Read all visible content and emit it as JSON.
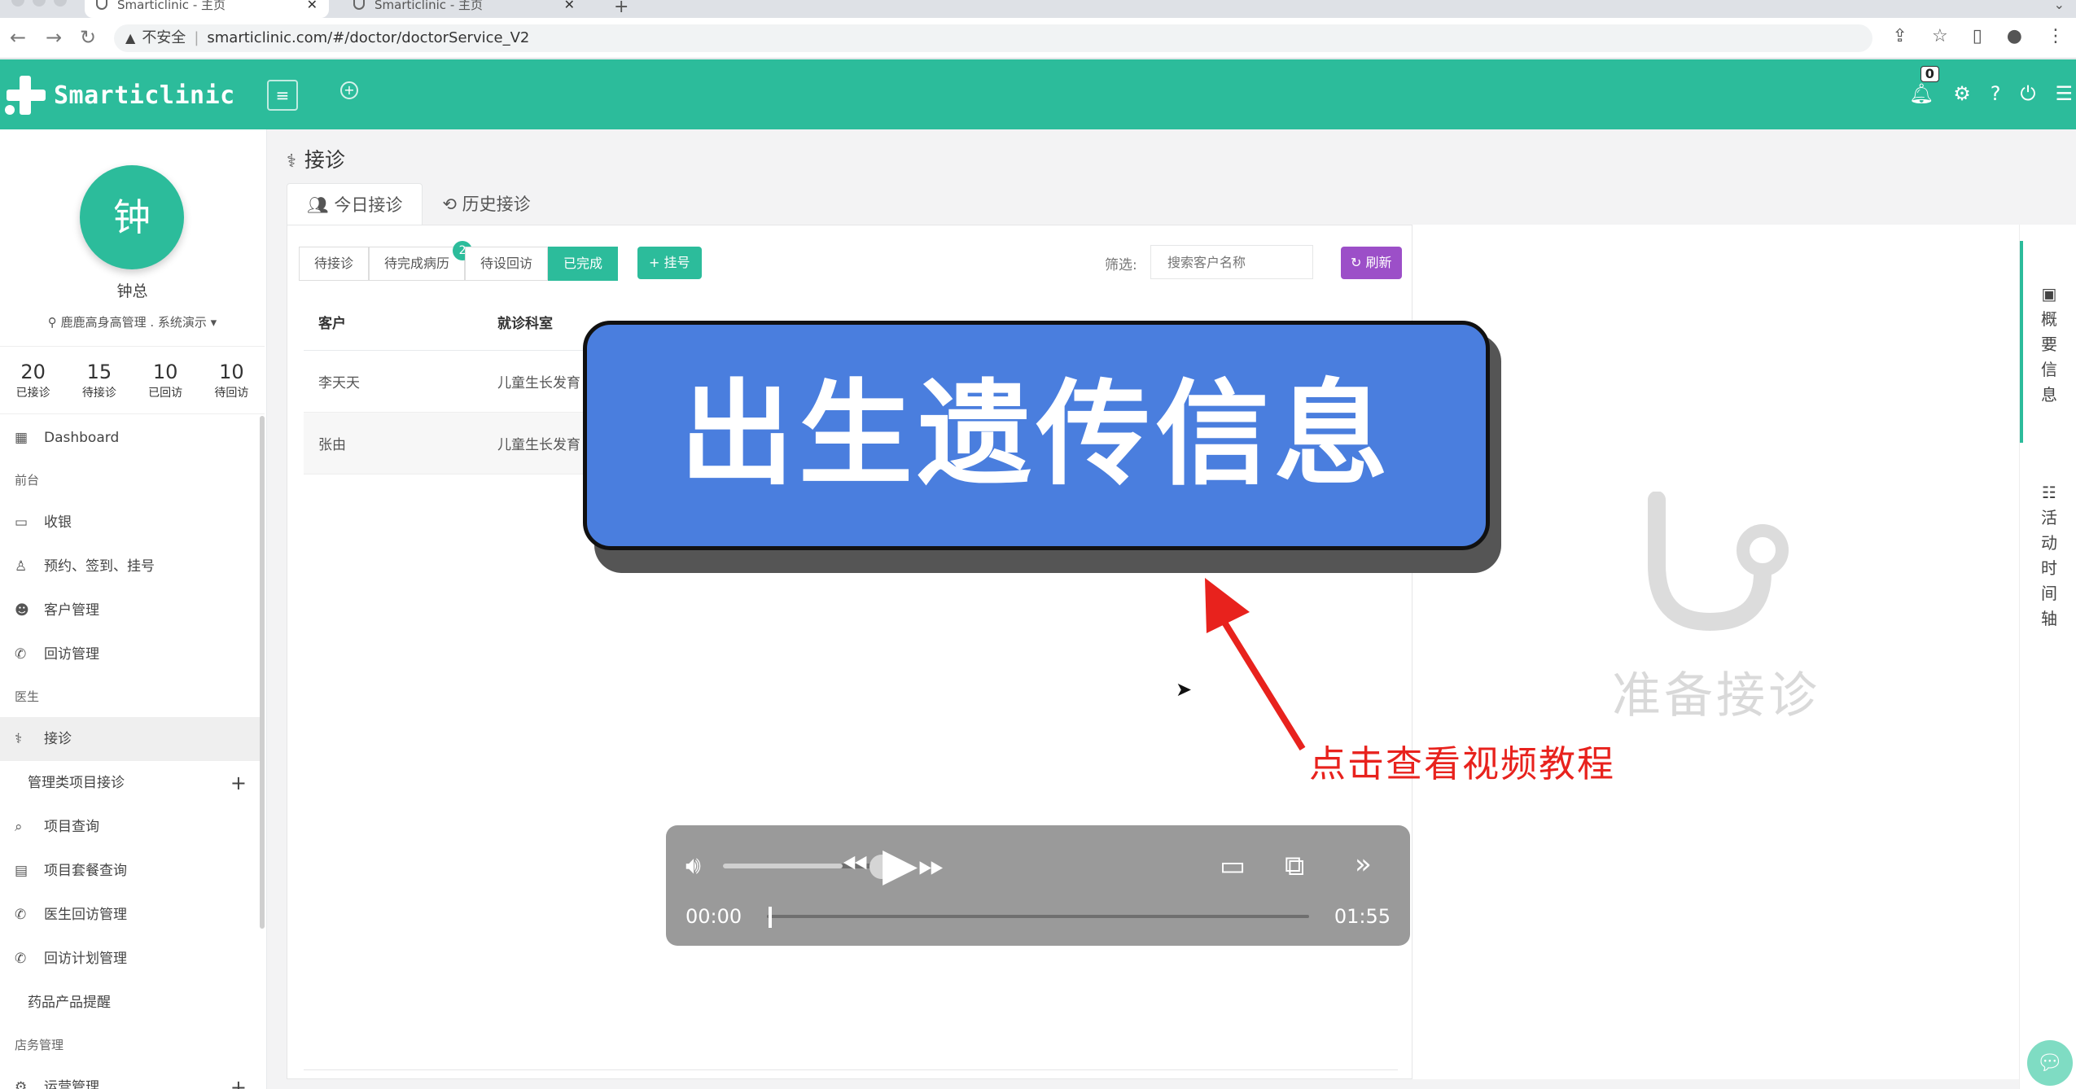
{
  "browser": {
    "tabs": [
      {
        "title": "Smarticlinic - 主页",
        "active": true
      },
      {
        "title": "Smarticlinic - 主页",
        "active": false
      }
    ],
    "security_label": "不安全",
    "url": "smarticlinic.com/#/doctor/doctorService_V2"
  },
  "header": {
    "logo_text": "Smarticlinic",
    "notification_count": "0",
    "brand_color": "#2cbc9b"
  },
  "sidebar": {
    "avatar_char": "钟",
    "user_name": "钟总",
    "org": "鹿鹿高身高管理 . 系统演示",
    "stats": [
      {
        "num": "20",
        "label": "已接诊"
      },
      {
        "num": "15",
        "label": "待接诊"
      },
      {
        "num": "10",
        "label": "已回访"
      },
      {
        "num": "10",
        "label": "待回访"
      }
    ],
    "dashboard": "Dashboard",
    "section_front": "前台",
    "cashier": "收银",
    "appointments": "预约、签到、挂号",
    "customers": "客户管理",
    "followup": "回访管理",
    "section_doctor": "医生",
    "consult": "接诊",
    "mgmt_projects": "管理类项目接诊",
    "project_query": "项目查询",
    "package_query": "项目套餐查询",
    "doctor_followup": "医生回访管理",
    "followup_plan": "回访计划管理",
    "drug_reminder": "药品产品提醒",
    "section_store": "店务管理",
    "operations": "运营管理"
  },
  "main": {
    "title": "接诊",
    "tab_today": "今日接诊",
    "tab_history": "历史接诊",
    "status": {
      "pending": "待接诊",
      "incomplete": "待完成病历",
      "incomplete_badge": "2",
      "followup": "待设回访",
      "done": "已完成"
    },
    "register": "+ 挂号",
    "filter_label": "筛选:",
    "search_placeholder": "搜索客户名称",
    "refresh": "刷新",
    "columns": [
      "客户",
      "就诊科室"
    ],
    "rows": [
      [
        "李天天",
        "儿童生长发育"
      ],
      [
        "张由",
        "儿童生长发育"
      ]
    ]
  },
  "detail": {
    "ready": "准备接诊",
    "tab_overview": [
      "概",
      "要",
      "信",
      "息"
    ],
    "tab_timeline": [
      "活",
      "动",
      "时",
      "间",
      "轴"
    ]
  },
  "overlay": {
    "banner": "出生遗传信息",
    "callout": "点击查看视频教程",
    "banner_color": "#4a7ede",
    "callout_color": "#e8221d"
  },
  "player": {
    "current_time": "00:00",
    "total_time": "01:55",
    "volume": 0.78,
    "progress": 0.0
  }
}
